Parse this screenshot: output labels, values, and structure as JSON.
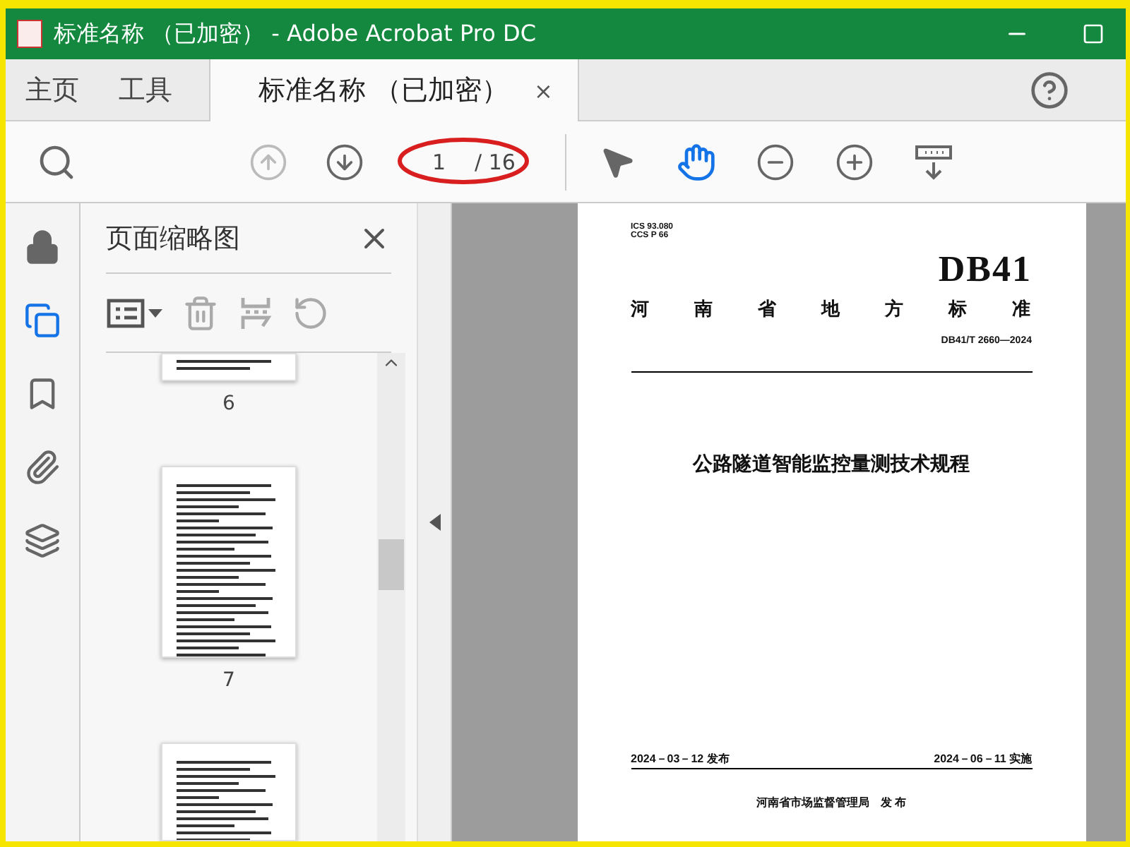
{
  "window": {
    "title": "标准名称 （已加密） - Adobe Acrobat Pro DC"
  },
  "tabs": [
    {
      "label": "主页",
      "selected": false,
      "closable": false
    },
    {
      "label": "工具",
      "selected": false,
      "closable": false
    },
    {
      "label": "标准名称 （已加密）",
      "selected": true,
      "closable": true,
      "close_glyph": "×"
    }
  ],
  "toolbar": {
    "page_value": "1",
    "page_total": "/ 16",
    "annotation_circled": true,
    "tools": [
      {
        "kind": "prev",
        "disabled": true,
        "selected": false
      },
      {
        "kind": "next",
        "disabled": false,
        "selected": false
      },
      {
        "kind": "pointer",
        "disabled": false,
        "selected": false
      },
      {
        "kind": "hand",
        "disabled": false,
        "selected": true
      },
      {
        "kind": "zoom-out",
        "disabled": false,
        "selected": false
      },
      {
        "kind": "zoom-in",
        "disabled": false,
        "selected": false
      },
      {
        "kind": "keyboard",
        "disabled": false,
        "selected": false
      }
    ]
  },
  "rail": [
    {
      "kind": "lock",
      "selected": false
    },
    {
      "kind": "pages",
      "selected": true
    },
    {
      "kind": "bookmark",
      "selected": false
    },
    {
      "kind": "attachment",
      "selected": false
    },
    {
      "kind": "layers",
      "selected": false
    }
  ],
  "panel": {
    "title": "页面缩略图",
    "tools": [
      {
        "kind": "options",
        "disabled": false
      },
      {
        "kind": "delete",
        "disabled": true
      },
      {
        "kind": "extract",
        "disabled": true
      },
      {
        "kind": "rotate",
        "disabled": true
      }
    ],
    "thumbnails": [
      {
        "label": "6",
        "cut_off": true,
        "selected": false
      },
      {
        "label": "7",
        "cut_off": false,
        "selected": false
      }
    ],
    "partial_next_thumbnail": true
  },
  "document": {
    "ics": "ICS 93.080",
    "ccs": "CCS P 66",
    "code": "DB41",
    "category": "河南省地方标准",
    "number": "DB41/T 2660—2024",
    "title": "公路隧道智能监控量测技术规程",
    "issue_date": "2024－03－12 发布",
    "effective_date": "2024－06－11 实施",
    "issuer": "河南省市场监督管理局　发 布"
  }
}
